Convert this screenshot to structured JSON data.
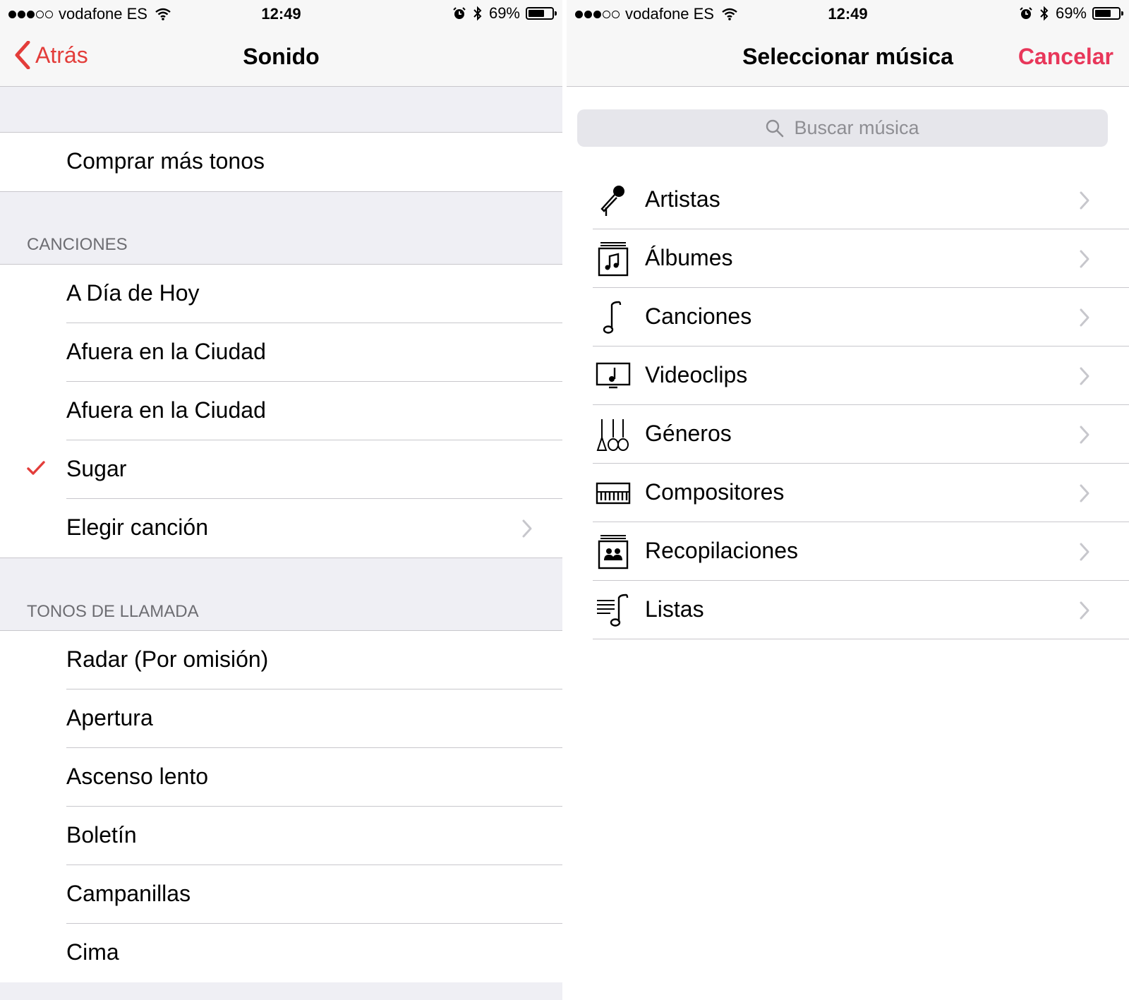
{
  "status_bar": {
    "carrier": "vodafone ES",
    "time": "12:49",
    "battery": "69%",
    "battery_level": 0.69,
    "signal_bars_filled": 3,
    "signal_bars_total": 5
  },
  "left": {
    "nav": {
      "back_label": "Atrás",
      "title": "Sonido"
    },
    "store_row": "Comprar más tonos",
    "songs_header": "CANCIONES",
    "songs": [
      "A Día de Hoy",
      "Afuera en la Ciudad",
      "Afuera en la Ciudad",
      "Sugar",
      "Elegir canción"
    ],
    "selected_song": "Sugar",
    "ringtones_header": "TONOS DE LLAMADA",
    "ringtones": [
      "Radar (Por omisión)",
      "Apertura",
      "Ascenso lento",
      "Boletín",
      "Campanillas",
      "Cima"
    ]
  },
  "right": {
    "nav": {
      "title": "Seleccionar música",
      "cancel_label": "Cancelar"
    },
    "search_placeholder": "Buscar música",
    "categories": [
      {
        "label": "Artistas",
        "icon": "microphone-icon"
      },
      {
        "label": "Álbumes",
        "icon": "album-icon"
      },
      {
        "label": "Canciones",
        "icon": "music-note-icon"
      },
      {
        "label": "Videoclips",
        "icon": "video-icon"
      },
      {
        "label": "Géneros",
        "icon": "instruments-icon"
      },
      {
        "label": "Compositores",
        "icon": "piano-icon"
      },
      {
        "label": "Recopilaciones",
        "icon": "compilation-icon"
      },
      {
        "label": "Listas",
        "icon": "playlist-icon"
      }
    ]
  },
  "colors": {
    "accent_red": "#e33d3a",
    "cancel_pink": "#e8375a",
    "group_bg": "#efeff4",
    "separator": "#c8c7cc"
  }
}
